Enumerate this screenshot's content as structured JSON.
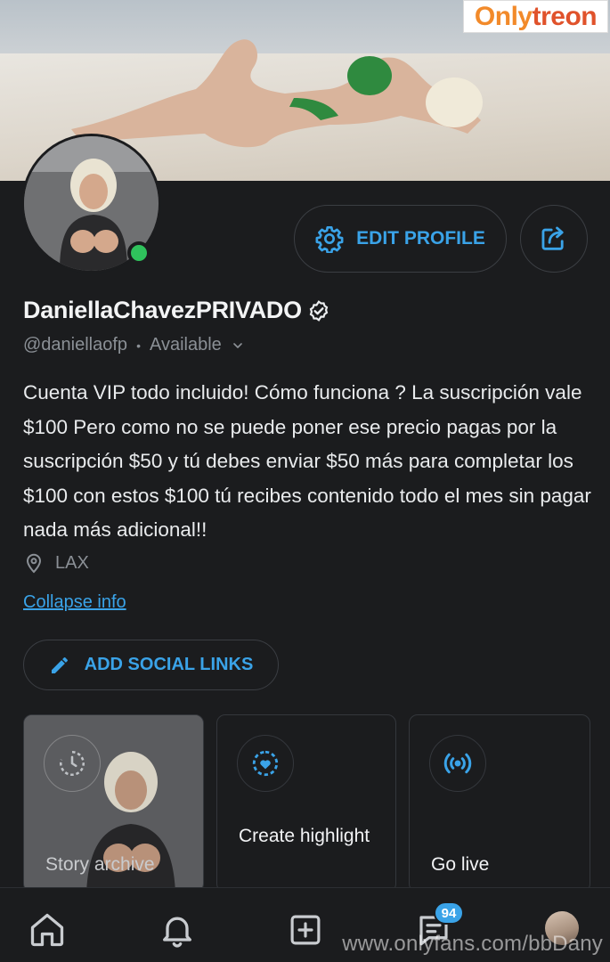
{
  "watermark": {
    "brand_part1": "Only",
    "brand_part2": "treon",
    "url": "www.onlyfans.com/bbDany"
  },
  "profile": {
    "name": "DaniellaChavezPRIVADO",
    "handle": "@daniellaofp",
    "status": "Available",
    "bio": "Cuenta VIP todo incluido! Cómo funciona ? La suscripción vale $100 Pero como no se puede poner ese precio pagas por la suscripción $50 y tú debes enviar $50 más para completar los $100 con estos $100 tú recibes contenido todo el mes sin pagar nada más adicional!!",
    "location": "LAX",
    "verified_icon": "verified-badge-icon"
  },
  "actions": {
    "edit_profile": "EDIT PROFILE",
    "collapse_info": "Collapse info",
    "add_social_links": "ADD SOCIAL LINKS"
  },
  "cards": [
    {
      "label": "Story archive",
      "icon": "clock-history-icon"
    },
    {
      "label": "Create highlight",
      "icon": "highlight-heart-icon"
    },
    {
      "label": "Go live",
      "icon": "broadcast-icon"
    }
  ],
  "nav": {
    "items": [
      "home-icon",
      "bell-icon",
      "add-post-icon",
      "messages-icon",
      "profile-avatar"
    ],
    "messages_badge": "94"
  },
  "colors": {
    "accent": "#3aa3e8",
    "online": "#2fc25c",
    "background": "#1b1c1e"
  }
}
